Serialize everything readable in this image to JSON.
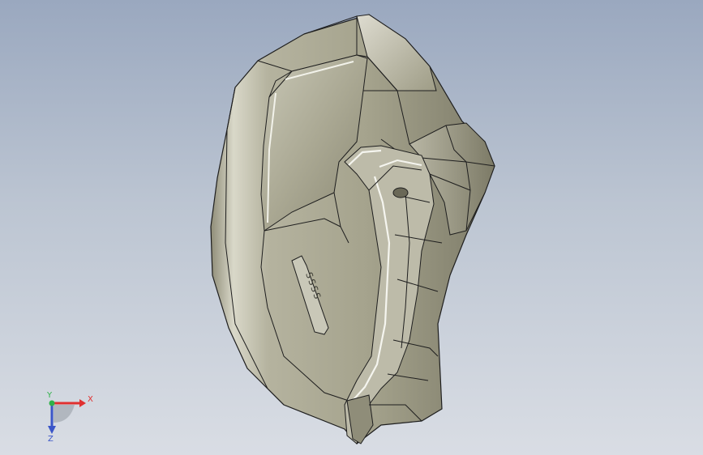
{
  "viewport": {
    "background_top": "#9aa8bf",
    "background_bottom": "#d9dde4"
  },
  "model": {
    "icon": "3d-part-model",
    "face_color": "#aeac98",
    "edge_color": "#1e1e1e",
    "embossed_text": "SSSS"
  },
  "triad": {
    "x_label": "X",
    "y_label": "Y",
    "z_label": "Z",
    "x_color": "#e03030",
    "y_color": "#2fb24a",
    "z_color": "#3a55c8"
  }
}
